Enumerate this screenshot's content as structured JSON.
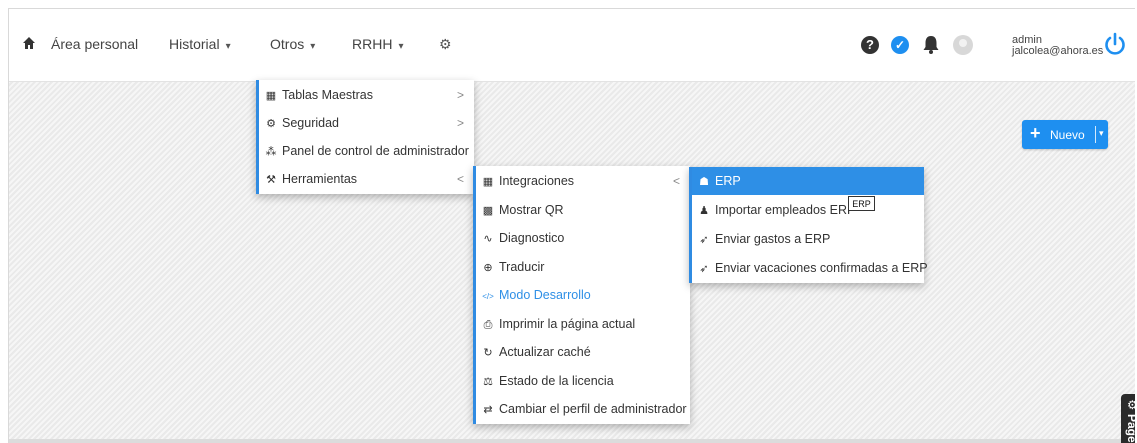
{
  "nav": {
    "items": [
      {
        "label": "Área personal",
        "caret": ""
      },
      {
        "label": "Historial",
        "caret": "▾"
      },
      {
        "label": "Otros",
        "caret": "▾"
      },
      {
        "label": "RRHH",
        "caret": "▾"
      }
    ],
    "cog_glyph": "⚙",
    "icons": [
      "home-icon",
      "settings-icon"
    ]
  },
  "header_right": {
    "icons": [
      "help-icon",
      "check-icon",
      "bell-icon",
      "avatar",
      "power-icon"
    ],
    "help_glyph": "?",
    "check_glyph": "✓",
    "user_name": "admin",
    "user_email": "jalcolea@ahora.es"
  },
  "menu_otros": {
    "items": [
      {
        "icon": "▦",
        "label": "Tablas Maestras",
        "arrow": ">"
      },
      {
        "icon": "⚙",
        "label": "Seguridad",
        "arrow": ">"
      },
      {
        "icon": "⁂",
        "label": "Panel de control de administrador",
        "arrow": ""
      },
      {
        "icon": "⚒",
        "label": "Herramientas",
        "arrow": "<"
      }
    ]
  },
  "menu_herramientas": {
    "items": [
      {
        "icon": "▦",
        "label": "Integraciones",
        "arrow": "<"
      },
      {
        "icon": "▩",
        "label": "Mostrar QR",
        "arrow": ""
      },
      {
        "icon": "∿",
        "label": "Diagnostico",
        "arrow": ""
      },
      {
        "icon": "⊕",
        "label": "Traducir",
        "arrow": ""
      },
      {
        "icon": "</>",
        "label": "Modo Desarrollo",
        "arrow": ""
      },
      {
        "icon": "⎙",
        "label": "Imprimir la página actual",
        "arrow": ""
      },
      {
        "icon": "↻",
        "label": "Actualizar caché",
        "arrow": ""
      },
      {
        "icon": "⚖",
        "label": "Estado de la licencia",
        "arrow": ""
      },
      {
        "icon": "⇄",
        "label": "Cambiar el perfil de administrador",
        "arrow": ""
      }
    ]
  },
  "menu_integraciones": {
    "items": [
      {
        "icon": "☗",
        "label": "ERP"
      },
      {
        "icon": "♟",
        "label": "Importar empleados ERP"
      },
      {
        "icon": "➶",
        "label": "Enviar gastos a ERP"
      },
      {
        "icon": "➶",
        "label": "Enviar vacaciones confirmadas a ERP"
      }
    ]
  },
  "tooltip": "ERP",
  "nuevo_button": {
    "plus": "+",
    "label": "Nuevo",
    "dropdown": "▾"
  },
  "page_tab": {
    "label": "Page",
    "gear": "⚙"
  },
  "colors": {
    "accent": "#2e8fe6",
    "button": "#1e8ff0",
    "background": "#efefef"
  }
}
